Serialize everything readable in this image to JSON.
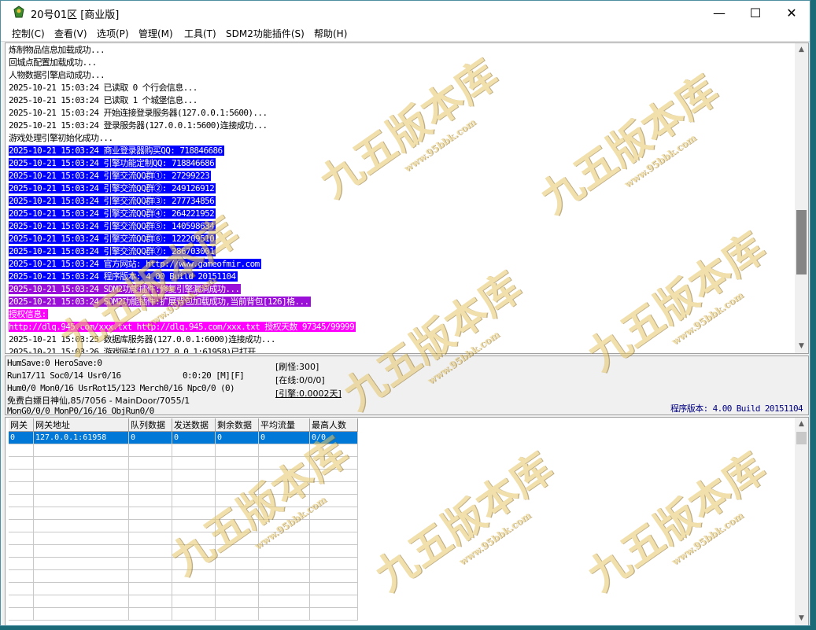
{
  "window": {
    "title": "20号01区 [商业版]",
    "minimize": "—",
    "maximize": "☐",
    "close": "✕"
  },
  "menu": [
    "控制(C)",
    "查看(V)",
    "选项(P)",
    "管理(M)",
    "工具(T)",
    "SDM2功能插件(S)",
    "帮助(H)"
  ],
  "log": [
    {
      "text": "炼制物品信息加载成功...",
      "style": "normal"
    },
    {
      "text": "回城点配置加载成功...",
      "style": "normal"
    },
    {
      "text": "人物数据引擎启动成功...",
      "style": "normal"
    },
    {
      "text": "2025-10-21 15:03:24 已读取 0 个行会信息...",
      "style": "normal"
    },
    {
      "text": "2025-10-21 15:03:24 已读取 1 个城堡信息...",
      "style": "normal"
    },
    {
      "text": "2025-10-21 15:03:24 开始连接登录服务器(127.0.0.1:5600)...",
      "style": "normal"
    },
    {
      "text": "2025-10-21 15:03:24 登录服务器(127.0.0.1:5600)连接成功...",
      "style": "normal"
    },
    {
      "text": "游戏处理引擎初始化成功...",
      "style": "normal"
    },
    {
      "text": "2025-10-21 15:03:24 商业登录器购买QQ: 718846686",
      "style": "blue"
    },
    {
      "text": "2025-10-21 15:03:24 引擎功能定制QQ: 718846686",
      "style": "blue"
    },
    {
      "text": "2025-10-21 15:03:24 引擎交流QQ群①: 27299223",
      "style": "blue"
    },
    {
      "text": "2025-10-21 15:03:24 引擎交流QQ群②: 249126912",
      "style": "blue"
    },
    {
      "text": "2025-10-21 15:03:24 引擎交流QQ群③: 277734856",
      "style": "blue"
    },
    {
      "text": "2025-10-21 15:03:24 引擎交流QQ群④: 264221952",
      "style": "blue"
    },
    {
      "text": "2025-10-21 15:03:24 引擎交流QQ群⑤: 140598634",
      "style": "blue"
    },
    {
      "text": "2025-10-21 15:03:24 引擎交流QQ群⑥: 122209510",
      "style": "blue"
    },
    {
      "text": "2025-10-21 15:03:24 引擎交流QQ群⑦: 286703001",
      "style": "blue"
    },
    {
      "text": "2025-10-21 15:03:24 官方网站: http://www.gameofmir.com",
      "style": "blue"
    },
    {
      "text": "2025-10-21 15:03:24 程序版本: 4.00 Build 20151104",
      "style": "blue"
    },
    {
      "text": "2025-10-21 15:03:24 SDM2功能插件:修复引擎漏洞成功...",
      "style": "purple"
    },
    {
      "text": "2025-10-21 15:03:24 SDM2功能插件:扩展背包加载成功,当前背包[126]格...",
      "style": "purple"
    },
    {
      "text": "授权信息:",
      "style": "magenta"
    },
    {
      "text": "http://dlq.945.com/xxx.txt http://dlq.945.com/xxx.txt 授权天数 97345/99999",
      "style": "magenta"
    },
    {
      "text": "2025-10-21 15:03:25 数据库服务器(127.0.0.1:6000)连接成功...",
      "style": "normal"
    },
    {
      "text": "2025-10-21 15:03:26 游戏网关[0](127.0.0.1:61958)已打开...",
      "style": "normal"
    }
  ],
  "status": {
    "line1": "HumSave:0 HeroSave:0",
    "line2": "Run17/11 Soc0/14 Usr0/16",
    "timer": "0:0:20 [M][F]",
    "line3": "Hum0/0 Mon0/16 UsrRot15/123 Merch0/16 Npc0/0 (0)",
    "line4": "免费白嫖日神仙,85/7056 - MainDoor/7055/1",
    "line5": "MonG0/0/0 MonP0/16/16 ObjRun0/0",
    "refresh": "[刷怪:300]",
    "online": "[在线:0/0/0]",
    "engine": "[引擎:0.0002天]",
    "version": "程序版本: 4.00 Build 20151104"
  },
  "gate_table": {
    "headers": [
      "网关",
      "网关地址",
      "队列数据",
      "发送数据",
      "剩余数据",
      "平均流量",
      "最高人数"
    ],
    "rows": [
      [
        "0",
        "127.0.0.1:61958",
        "0",
        "0",
        "0",
        "0",
        "0/0"
      ]
    ]
  },
  "watermark": {
    "text": "九五版本库",
    "url": "www.95bbk.com"
  }
}
